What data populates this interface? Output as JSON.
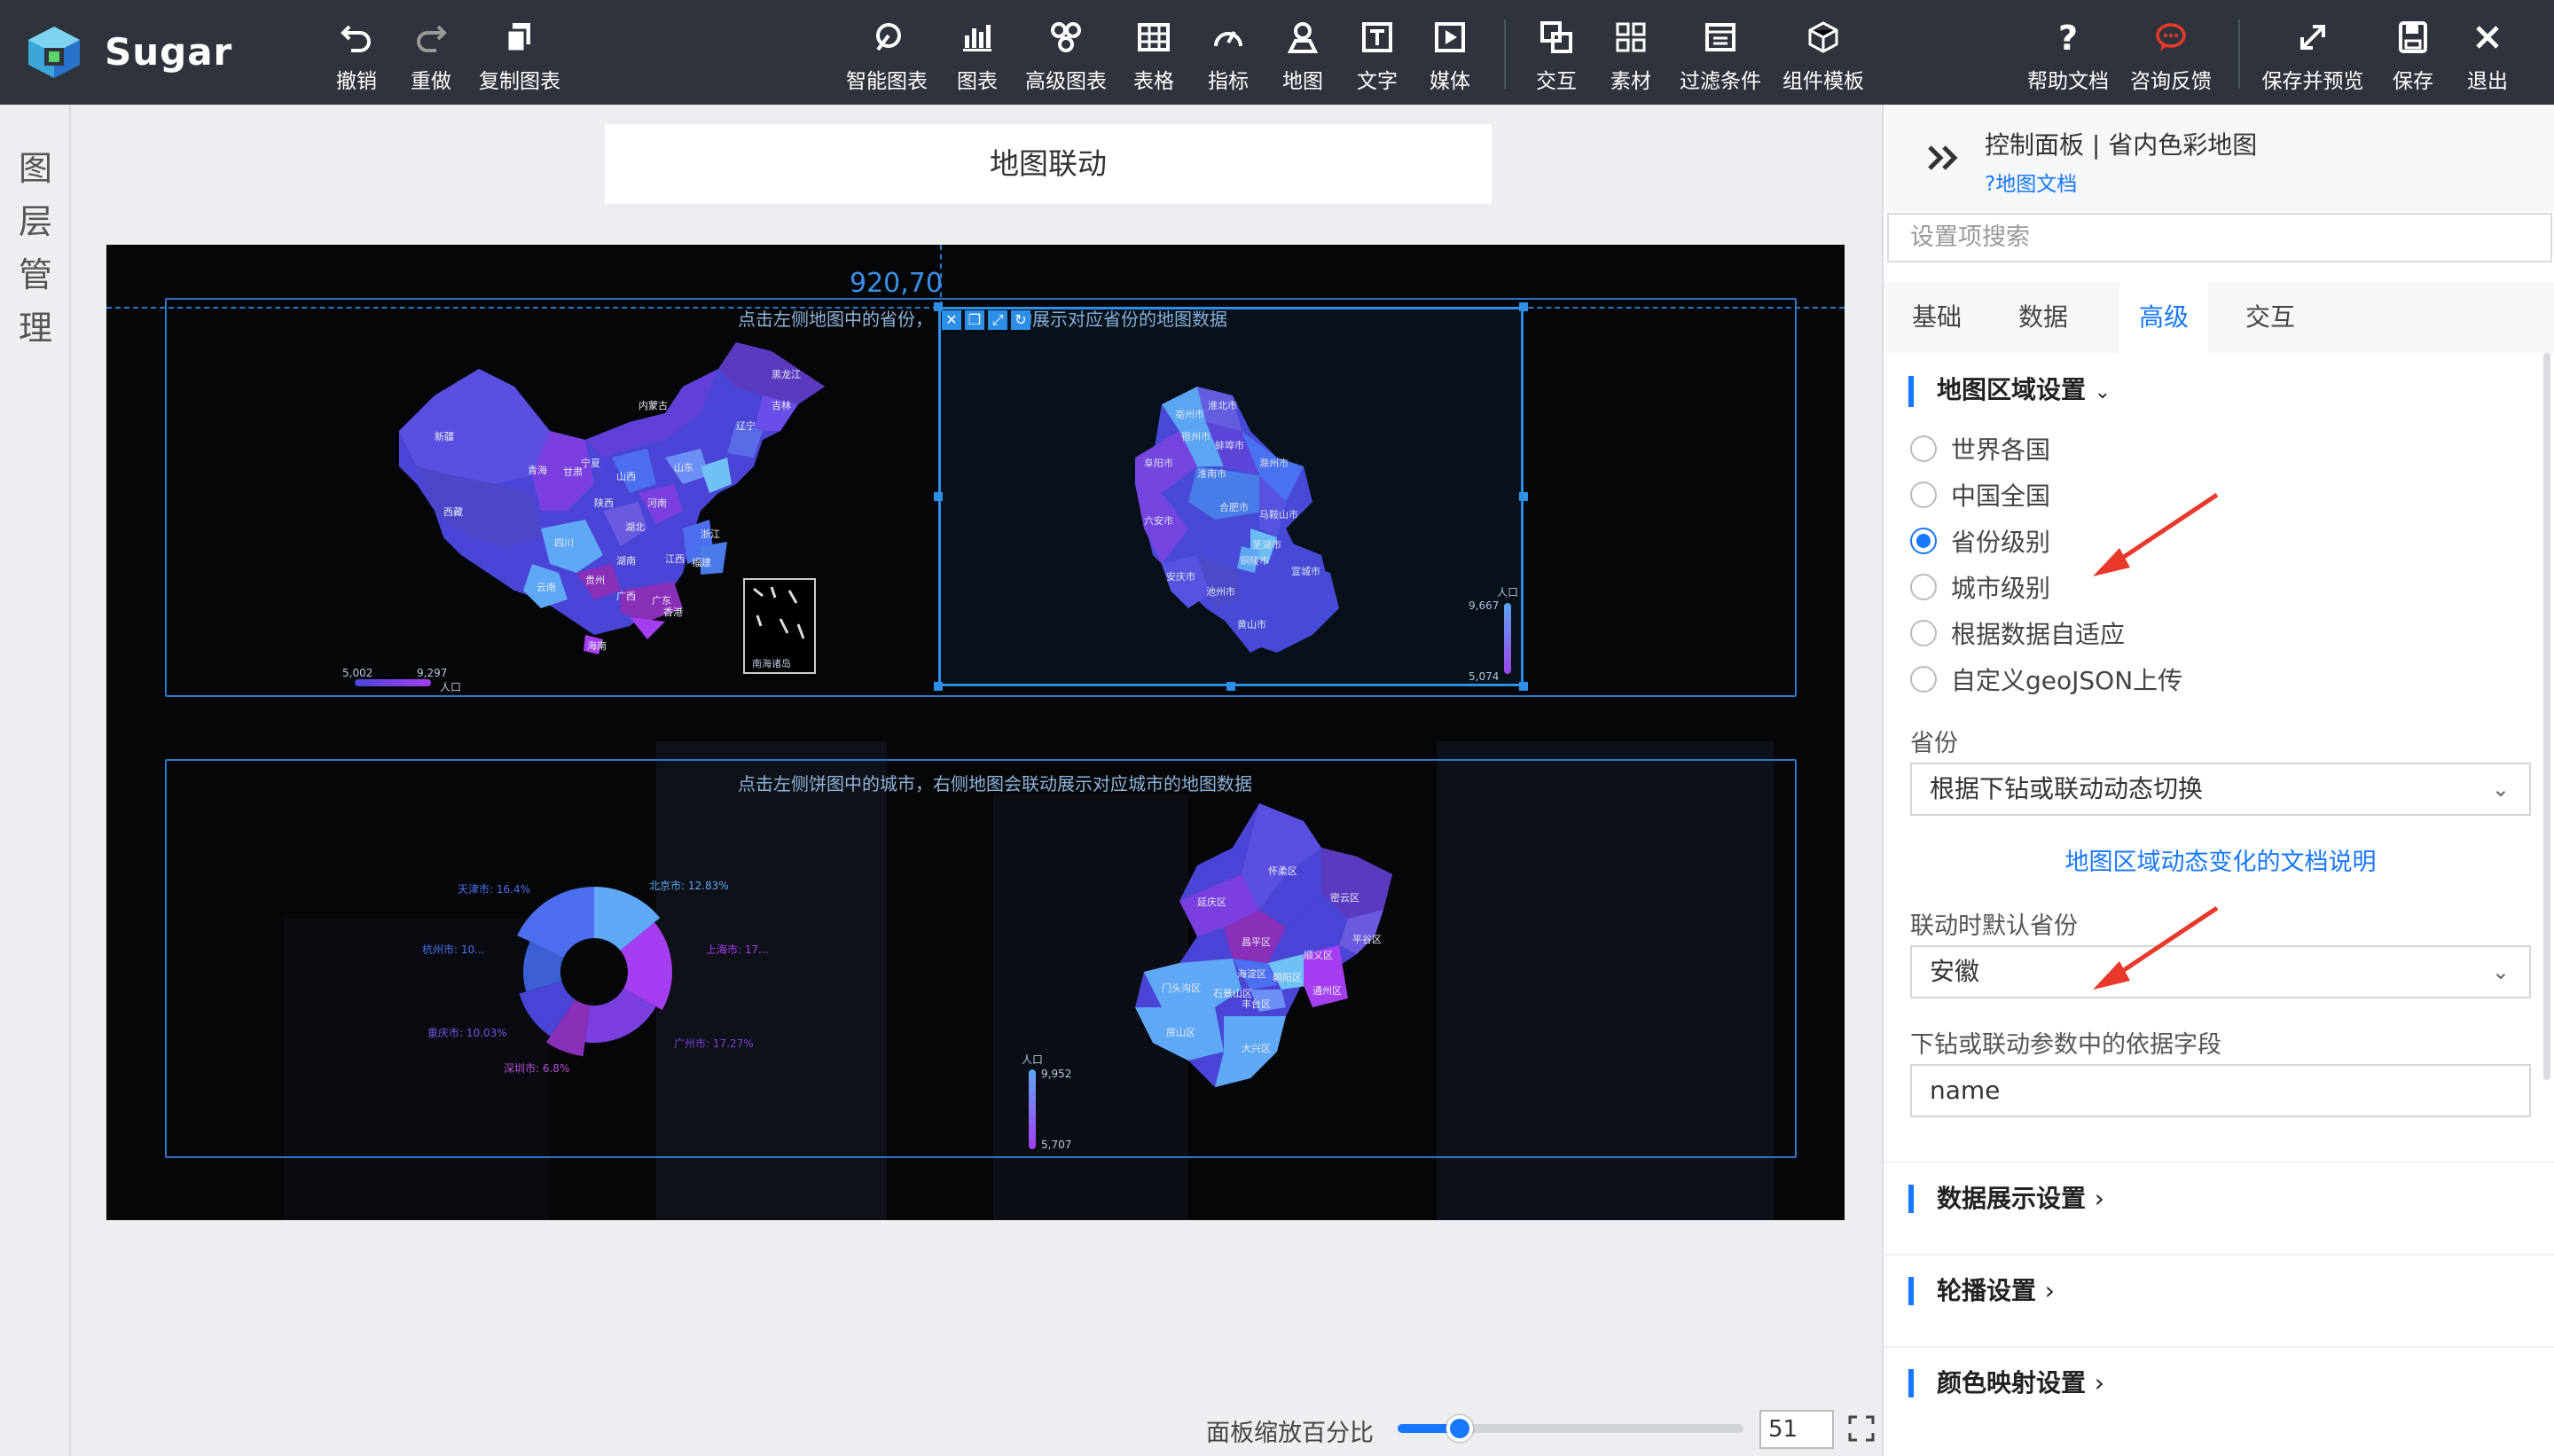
{
  "app": {
    "brand": "Sugar"
  },
  "toolbar": {
    "undo": "撤销",
    "redo": "重做",
    "copy": "复制图表",
    "smart_chart": "智能图表",
    "chart": "图表",
    "advanced_chart": "高级图表",
    "table": "表格",
    "metric": "指标",
    "map": "地图",
    "text": "文字",
    "media": "媒体",
    "interaction": "交互",
    "assets": "素材",
    "filters": "过滤条件",
    "component_template": "组件模板",
    "help_docs": "帮助文档",
    "feedback": "咨询反馈",
    "save_preview": "保存并预览",
    "save": "保存",
    "exit": "退出"
  },
  "layer_rail": {
    "label_chars": [
      "图",
      "层",
      "管",
      "理"
    ]
  },
  "canvas": {
    "page_title": "地图联动",
    "coord_readout": "920,70",
    "top_panel_caption": "点击左侧地图中的省份，右侧地图会联动展示对应省份的地图数据",
    "top_caption_visible_left": "点击左侧地图中的省份，",
    "top_caption_visible_right": "动展示对应省份的地图数据",
    "bottom_panel_caption": "点击左侧饼图中的城市，右侧地图会联动展示对应城市的地图数据",
    "china_map": {
      "labels": [
        "新疆",
        "西藏",
        "青海",
        "甘肃",
        "内蒙古",
        "黑龙江",
        "吉林",
        "辽宁",
        "四川",
        "云南",
        "贵州",
        "广西",
        "广东",
        "湖南",
        "湖北",
        "河南",
        "山西",
        "陕西",
        "宁夏",
        "山东",
        "江西",
        "福建",
        "浙江",
        "海南",
        "香港"
      ],
      "legend_min": "5,002",
      "legend_max": "9,297",
      "legend_title": "人口",
      "inset_label": "南海诸岛"
    },
    "anhui_map": {
      "labels": [
        "亳州市",
        "淮北市",
        "阜阳市",
        "宿州市",
        "蚌埠市",
        "淮南市",
        "滁州市",
        "六安市",
        "合肥市",
        "马鞍山市",
        "芜湖市",
        "铜陵市",
        "宣城市",
        "安庆市",
        "池州市",
        "黄山市"
      ],
      "legend_title": "人口",
      "legend_max": "9,667",
      "legend_min": "5,074"
    },
    "pie": {
      "labels": [
        "北京市: 12.83%",
        "上海市: 17...",
        "广州市: 17.27%",
        "深圳市: 6.8%",
        "重庆市: 10.03%",
        "杭州市: 10...",
        "天津市: 16.4%"
      ],
      "slices": [
        {
          "name": "北京市",
          "value": 12.83,
          "color": "#5fa8f5"
        },
        {
          "name": "上海市",
          "value": 17.4,
          "color": "#a43ef0"
        },
        {
          "name": "广州市",
          "value": 17.27,
          "color": "#7b3fe0"
        },
        {
          "name": "深圳市",
          "value": 6.8,
          "color": "#8a2fb8"
        },
        {
          "name": "重庆市",
          "value": 10.03,
          "color": "#4a45d6"
        },
        {
          "name": "杭州市",
          "value": 10.5,
          "color": "#3b5fd4"
        },
        {
          "name": "天津市",
          "value": 16.4,
          "color": "#4c6ff0"
        }
      ]
    },
    "beijing_map": {
      "labels": [
        "延庆区",
        "怀柔区",
        "密云区",
        "昌平区",
        "顺义区",
        "平谷区",
        "门头沟区",
        "海淀区",
        "石景山区",
        "朝阳区",
        "丰台区",
        "通州区",
        "房山区",
        "大兴区"
      ],
      "legend_title": "人口",
      "legend_max": "9,952",
      "legend_min": "5,707"
    },
    "zoom": {
      "label": "面板缩放百分比",
      "value": "51",
      "percent": 51
    }
  },
  "right_panel": {
    "title": "控制面板 | 省内色彩地图",
    "doc_link": "?地图文档",
    "search_placeholder": "设置项搜索",
    "tabs": [
      "基础",
      "数据",
      "高级",
      "交互"
    ],
    "active_tab": "高级",
    "map_area": {
      "heading": "地图区域设置",
      "options": [
        "世界各国",
        "中国全国",
        "省份级别",
        "城市级别",
        "根据数据自适应",
        "自定义geoJSON上传"
      ],
      "selected": "省份级别",
      "province_label": "省份",
      "province_value": "根据下钻或联动动态切换",
      "doc_link": "地图区域动态变化的文档说明",
      "default_province_label": "联动时默认省份",
      "default_province_value": "安徽",
      "field_label": "下钻或联动参数中的依据字段",
      "field_value": "name"
    },
    "sections": [
      "数据展示设置",
      "轮播设置",
      "颜色映射设置"
    ]
  },
  "colors": {
    "accent": "#1677ff",
    "topbar": "#2f343c",
    "annotation_arrow": "#e8392b"
  }
}
